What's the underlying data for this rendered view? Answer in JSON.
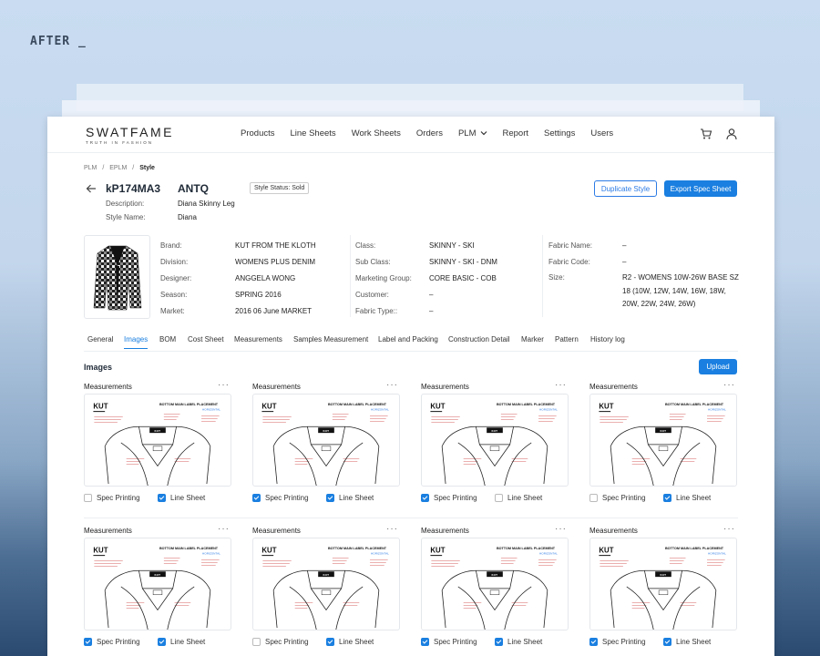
{
  "after_label": "AFTER _",
  "brand": {
    "name": "SWATFAME",
    "tagline": "TRUTH IN FASHION"
  },
  "nav": [
    "Products",
    "Line Sheets",
    "Work Sheets",
    "Orders",
    "PLM",
    "Report",
    "Settings",
    "Users"
  ],
  "icons": {
    "cart": "cart-icon",
    "user": "user-icon",
    "back": "arrow-left-icon",
    "more": "more-horizontal-icon",
    "chevron": "chevron-down-icon"
  },
  "breadcrumb": {
    "a": "PLM",
    "b": "EPLM",
    "c": "Style",
    "sep": "/"
  },
  "style": {
    "code": "kP174MA3",
    "name": "ANTQ",
    "status": "Style Status: Sold",
    "desc_label": "Description:",
    "desc_value": "Diana Skinny Leg",
    "stylename_label": "Style Name:",
    "stylename_value": "Diana"
  },
  "buttons": {
    "duplicate": "Duplicate Style",
    "export": "Export Spec Sheet",
    "upload": "Upload"
  },
  "details": {
    "col1": [
      {
        "k": "Brand:",
        "v": "KUT FROM THE KLOTH"
      },
      {
        "k": "Division:",
        "v": "WOMENS PLUS DENIM"
      },
      {
        "k": "Designer:",
        "v": "ANGGELA WONG"
      },
      {
        "k": "Season:",
        "v": "SPRING 2016"
      },
      {
        "k": "Market:",
        "v": "2016 06 June MARKET"
      }
    ],
    "col2": [
      {
        "k": "Class:",
        "v": "SKINNY - SKI"
      },
      {
        "k": "Sub Class:",
        "v": "SKINNY - SKI - DNM"
      },
      {
        "k": "Marketing Group:",
        "v": "CORE BASIC - COB"
      },
      {
        "k": "Customer:",
        "v": "–"
      },
      {
        "k": "Fabric Type::",
        "v": "–"
      }
    ],
    "col3": [
      {
        "k": "Fabric Name:",
        "v": "–"
      },
      {
        "k": "Fabric Code:",
        "v": "–"
      },
      {
        "k": "Size:",
        "v": "R2 - WOMENS 10W-26W BASE SZ"
      },
      {
        "k": "",
        "v": "18 (10W, 12W, 14W, 16W, 18W,"
      },
      {
        "k": "",
        "v": "20W, 22W, 24W, 26W)"
      }
    ]
  },
  "tabs": [
    "General",
    "Images",
    "BOM",
    "Cost Sheet",
    "Measurements",
    "Samples Measurement",
    "Label and Packing",
    "Construction Detail",
    "Marker",
    "Pattern",
    "History log"
  ],
  "active_tab": "Images",
  "section_title": "Images",
  "card_text": {
    "title": "Measurements",
    "kut": "KUT",
    "placement": "BOTTOM MAIN LABEL PLACEMENT",
    "orientation": "HORIZONTAL",
    "spec": "Spec Printing",
    "line": "Line Sheet"
  },
  "cards": [
    {
      "spec": false,
      "line": true
    },
    {
      "spec": true,
      "line": true
    },
    {
      "spec": true,
      "line": false
    },
    {
      "spec": false,
      "line": true
    },
    {
      "spec": true,
      "line": true
    },
    {
      "spec": false,
      "line": true
    },
    {
      "spec": true,
      "line": true
    },
    {
      "spec": true,
      "line": true
    }
  ],
  "colors": {
    "accent": "#1a7fe0",
    "label_red": "#d0302f"
  }
}
